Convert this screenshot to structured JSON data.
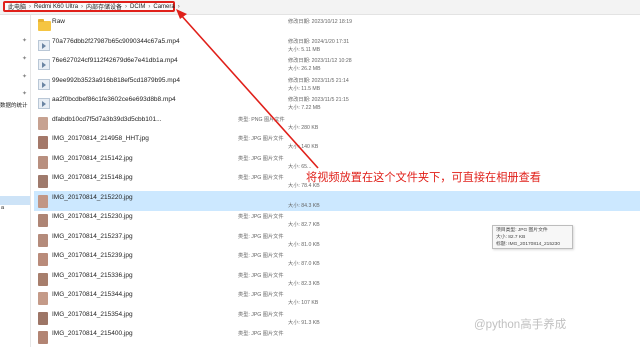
{
  "breadcrumb": [
    "此电脑",
    "Redmi K60 Ultra",
    "内部存储设备",
    "DCIM",
    "Camera"
  ],
  "sidebar": {
    "fragment": "数据的统计",
    "selected": "a"
  },
  "files": [
    {
      "name": "Raw",
      "kind": "folder",
      "type": "",
      "meta1": "修改日期: 2023/10/12 18:19",
      "meta2": ""
    },
    {
      "name": "70a776dbb2f27987b65c9090344c67a5.mp4",
      "kind": "video",
      "type": "",
      "meta1": "修改日期: 2024/1/20 17:31",
      "meta2": "大小: 5.11 MB"
    },
    {
      "name": "76e627024cf9112f42679d6e7e41db1a.mp4",
      "kind": "video",
      "type": "",
      "meta1": "修改日期: 2023/11/12 10:28",
      "meta2": "大小: 26.2 MB"
    },
    {
      "name": "99ee992b3523a916b818ef5cd1879b95.mp4",
      "kind": "video",
      "type": "",
      "meta1": "修改日期: 2023/11/5 21:14",
      "meta2": "大小: 11.5 MB"
    },
    {
      "name": "aa2f0bcdbef86c1fe3602ce6e693d8b8.mp4",
      "kind": "video",
      "type": "",
      "meta1": "修改日期: 2023/11/5 21:15",
      "meta2": "大小: 7.22 MB"
    },
    {
      "name": "dfabdb10cd7f5d7a3b39d3d5cbb101...",
      "kind": "image",
      "type": "类型: PNG 图片文件",
      "meta1": "",
      "meta2": "大小: 280 KB"
    },
    {
      "name": "IMG_20170814_214958_HHT.jpg",
      "kind": "image",
      "type": "类型: JPG 图片文件",
      "meta1": "",
      "meta2": "大小: 140 KB"
    },
    {
      "name": "IMG_20170814_215142.jpg",
      "kind": "image",
      "type": "类型: JPG 图片文件",
      "meta1": "",
      "meta2": "大小: 65..."
    },
    {
      "name": "IMG_20170814_215148.jpg",
      "kind": "image",
      "type": "类型: JPG 图片文件",
      "meta1": "",
      "meta2": "大小: 78.4 KB"
    },
    {
      "name": "IMG_20170814_215220.jpg",
      "kind": "image",
      "type": "",
      "meta1": "",
      "meta2": "大小: 84.3 KB",
      "selected": true
    },
    {
      "name": "IMG_20170814_215230.jpg",
      "kind": "image",
      "type": "类型: JPG 图片文件",
      "meta1": "",
      "meta2": "大小: 82.7 KB"
    },
    {
      "name": "IMG_20170814_215237.jpg",
      "kind": "image",
      "type": "类型: JPG 图片文件",
      "meta1": "",
      "meta2": "大小: 81.0 KB"
    },
    {
      "name": "IMG_20170814_215239.jpg",
      "kind": "image",
      "type": "类型: JPG 图片文件",
      "meta1": "",
      "meta2": "大小: 87.0 KB"
    },
    {
      "name": "IMG_20170814_215336.jpg",
      "kind": "image",
      "type": "类型: JPG 图片文件",
      "meta1": "",
      "meta2": "大小: 82.3 KB"
    },
    {
      "name": "IMG_20170814_215344.jpg",
      "kind": "image",
      "type": "类型: JPG 图片文件",
      "meta1": "",
      "meta2": "大小: 107 KB"
    },
    {
      "name": "IMG_20170814_215354.jpg",
      "kind": "image",
      "type": "类型: JPG 图片文件",
      "meta1": "",
      "meta2": "大小: 91.3 KB"
    },
    {
      "name": "IMG_20170814_215400.jpg",
      "kind": "image",
      "type": "类型: JPG 图片文件",
      "meta1": "",
      "meta2": ""
    }
  ],
  "tooltip": [
    "项目类型: JPG 图片文件",
    "大小: 82.7 KB",
    "标题: IMG_20170814_215230"
  ],
  "annotation": "将视频放置在这个文件夹下，可直接在相册查看",
  "watermark": "@python高手养成",
  "colors": {
    "annotation_red": "#e0201a",
    "selection_blue": "#cce8ff",
    "folder_yellow": "#f5c542"
  }
}
